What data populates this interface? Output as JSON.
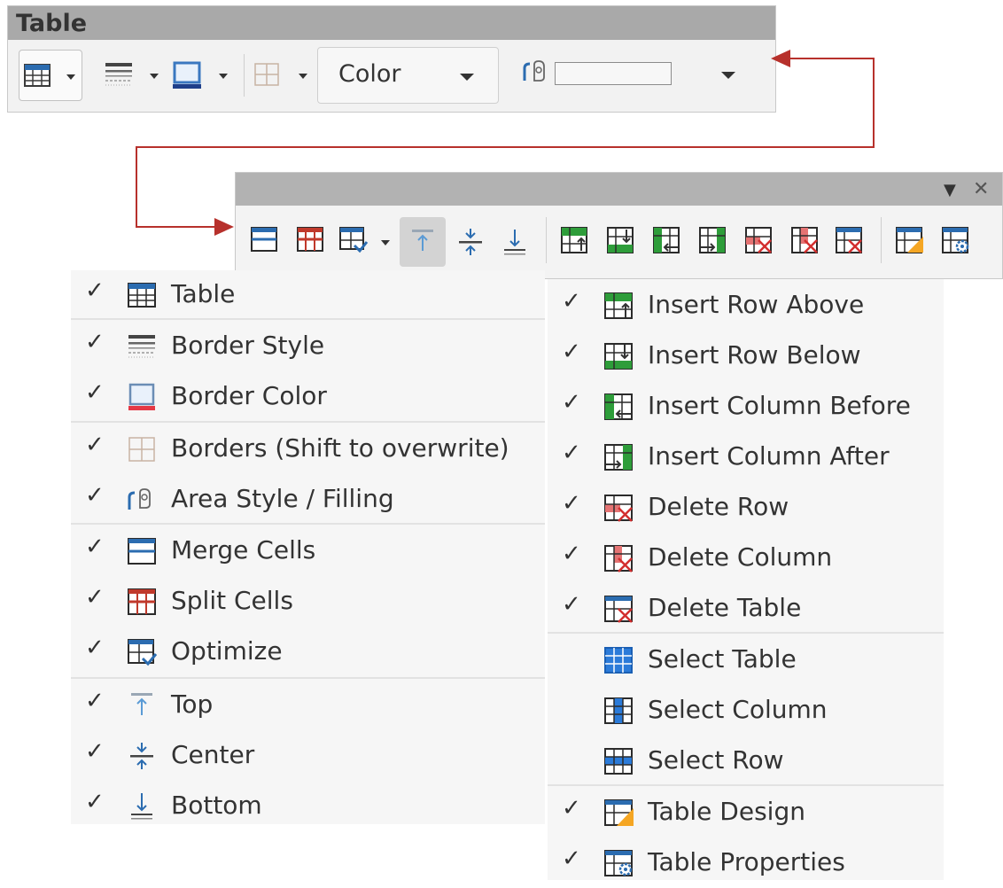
{
  "toolbar_table": {
    "title": "Table",
    "area_fill_value": "Color",
    "icons": [
      "table-icon",
      "border-style-icon",
      "border-color-icon",
      "borders-icon",
      "area-style-icon"
    ]
  },
  "toolbar_extended": {
    "icons": [
      "merge-cells-icon",
      "split-cells-icon",
      "optimize-icon",
      "align-top-icon",
      "align-center-icon",
      "align-bottom-icon",
      "insert-row-above-icon",
      "insert-row-below-icon",
      "insert-column-before-icon",
      "insert-column-after-icon",
      "delete-row-icon",
      "delete-column-icon",
      "delete-table-icon",
      "table-design-icon",
      "table-properties-icon"
    ],
    "menu_glyph": "▼",
    "close_glyph": "✕"
  },
  "menu_left": {
    "items": [
      {
        "label": "Table",
        "checked": true
      },
      {
        "label": "Border Style",
        "checked": true
      },
      {
        "label": "Border Color",
        "checked": true
      },
      {
        "label": "Borders (Shift to overwrite)",
        "checked": true
      },
      {
        "label": "Area Style / Filling",
        "checked": true
      },
      {
        "label": "Merge Cells",
        "checked": true
      },
      {
        "label": "Split Cells",
        "checked": true
      },
      {
        "label": "Optimize",
        "checked": true
      },
      {
        "label": "Top",
        "checked": true
      },
      {
        "label": "Center",
        "checked": true
      },
      {
        "label": "Bottom",
        "checked": true
      }
    ]
  },
  "menu_right": {
    "items": [
      {
        "label": "Insert Row Above",
        "checked": true
      },
      {
        "label": "Insert Row Below",
        "checked": true
      },
      {
        "label": "Insert Column Before",
        "checked": true
      },
      {
        "label": "Insert Column After",
        "checked": true
      },
      {
        "label": "Delete Row",
        "checked": true
      },
      {
        "label": "Delete Column",
        "checked": true
      },
      {
        "label": "Delete Table",
        "checked": true
      },
      {
        "label": "Select Table",
        "checked": false
      },
      {
        "label": "Select Column",
        "checked": false
      },
      {
        "label": "Select Row",
        "checked": false
      },
      {
        "label": "Table Design",
        "checked": true
      },
      {
        "label": "Table Properties",
        "checked": true
      }
    ]
  },
  "check_glyph": "✓",
  "colors": {
    "accent_red": "#b7312c",
    "grid_blue": "#2b6cb0",
    "green": "#2e9d3a",
    "title_bar": "#a9a9a9"
  }
}
